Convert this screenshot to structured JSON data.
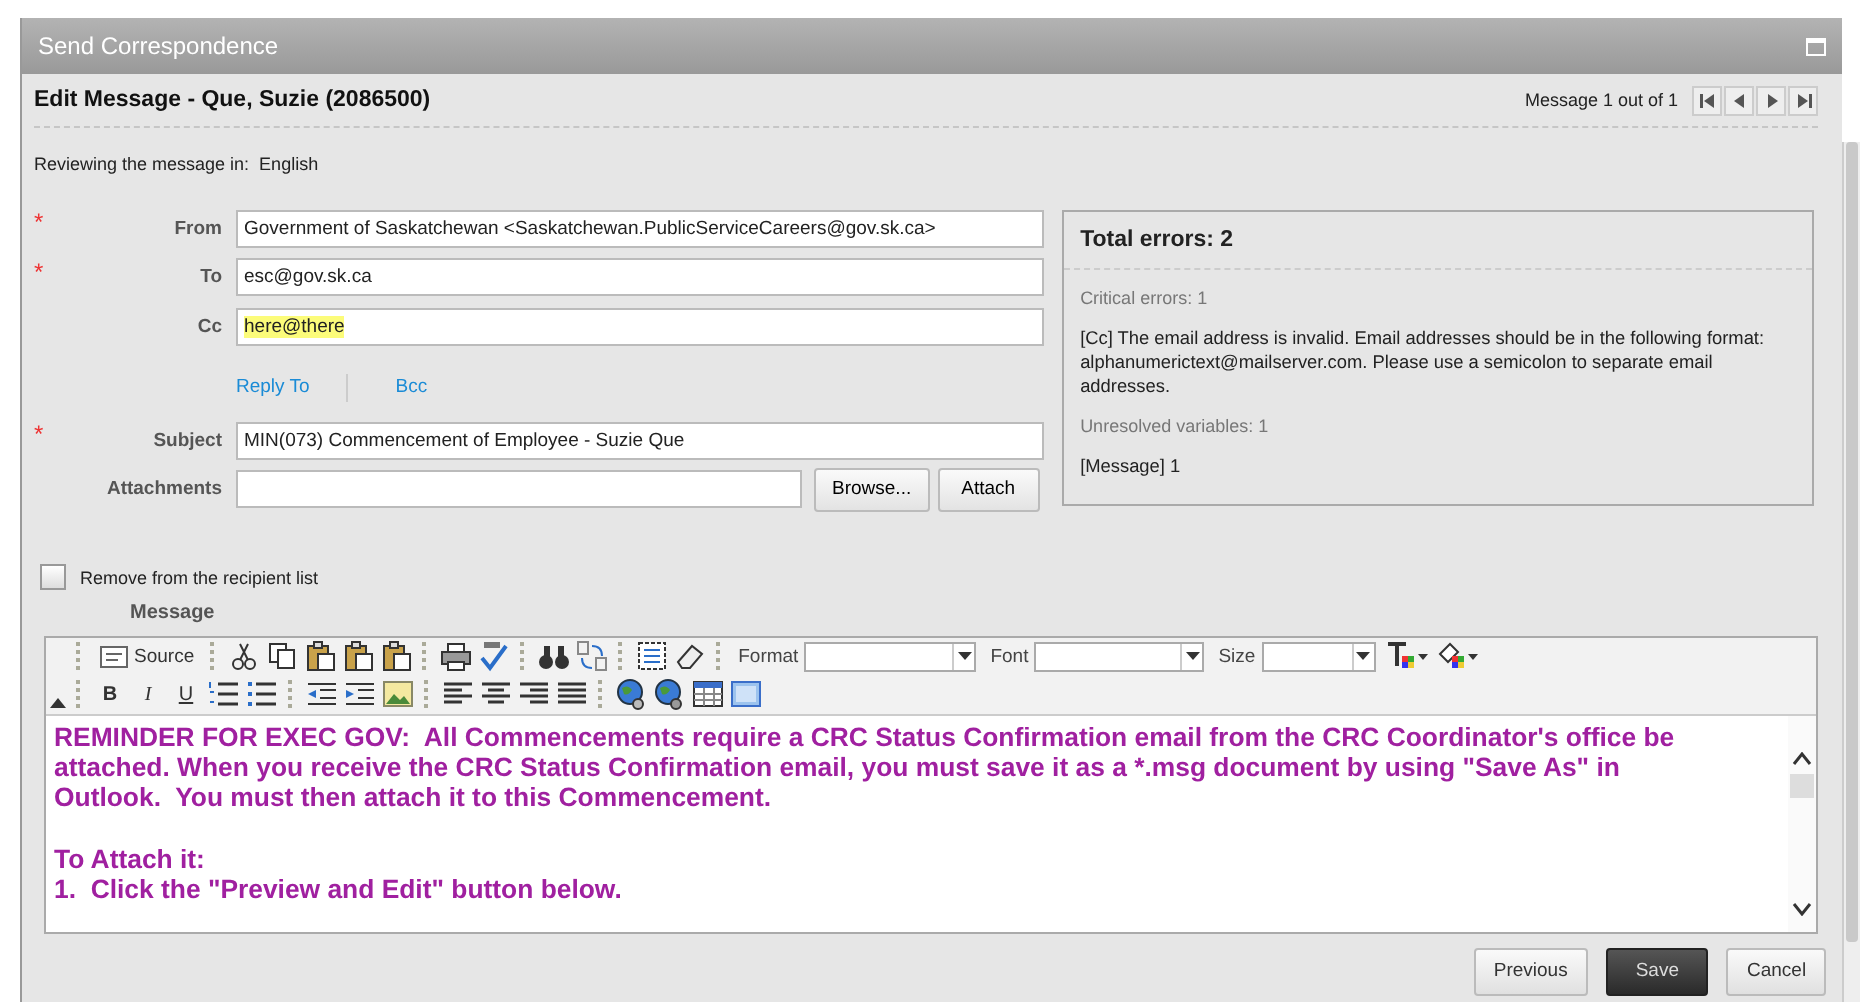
{
  "window": {
    "title": "Send Correspondence"
  },
  "header": {
    "title": "Edit Message - Que, Suzie (2086500)",
    "pager": "Message 1 out of 1"
  },
  "language": {
    "label": "Reviewing the message in:",
    "value": "English"
  },
  "fields": [
    {
      "kind": "text",
      "label": "From",
      "required_mark": "*",
      "value": "Government of Saskatchewan <Saskatchewan.PublicServiceCareers@gov.sk.ca>",
      "invalid": false
    },
    {
      "kind": "text",
      "label": "To",
      "required_mark": "*",
      "value": "esc@gov.sk.ca",
      "invalid": false
    },
    {
      "kind": "text",
      "label": "Cc",
      "value": "here@there",
      "invalid": true
    },
    {
      "kind": "links",
      "links": [
        "Reply To",
        "Bcc"
      ]
    },
    {
      "kind": "text",
      "label": "Subject",
      "required_mark": "*",
      "value": "MIN(073) Commencement of Employee - Suzie Que",
      "invalid": false
    },
    {
      "kind": "file",
      "label": "Attachments",
      "buttons": [
        "Browse...",
        "Attach"
      ]
    }
  ],
  "errors": {
    "title": "Total errors: 2",
    "sections": [
      {
        "heading": "Critical errors: 1",
        "text": "[Cc] The email address is invalid.  Email addresses should be in the following format: alphanumerictext@mailserver.com. Please use a semicolon to separate email addresses."
      },
      {
        "heading": "Unresolved variables: 1",
        "text": "[Message] 1"
      }
    ]
  },
  "remove_checkbox": {
    "label": "Remove from the recipient list",
    "checked": false
  },
  "message_label": "Message",
  "toolbar": {
    "source": "Source",
    "dropdowns": [
      "Format",
      "Font",
      "Size"
    ],
    "styles": [
      "B",
      "I",
      "U"
    ]
  },
  "body": [
    {
      "lines": [
        "REMINDER FOR EXEC GOV:  All Commencements require a CRC Status Confirmation email from the CRC Coordinator's office be attached. When you receive the CRC Status Confirmation email, you must save it as a *.msg document by using \"Save As\" in Outlook.  You must then attach it to this Commencement."
      ]
    },
    {
      "lines": [
        "To Attach it:",
        "1.  Click the \"Preview and Edit\" button below."
      ]
    }
  ],
  "buttons": [
    {
      "label": "Previous",
      "primary": false
    },
    {
      "label": "Save",
      "primary": true
    },
    {
      "label": "Cancel",
      "primary": false
    }
  ]
}
